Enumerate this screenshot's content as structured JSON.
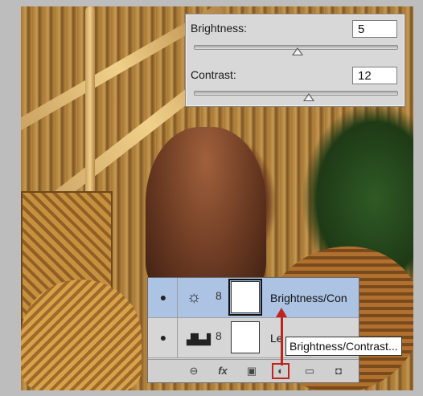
{
  "properties_panel": {
    "brightness_label": "Brightness:",
    "brightness_value": "5",
    "contrast_label": "Contrast:",
    "contrast_value": "12"
  },
  "layers_panel": {
    "layers": [
      {
        "name": "Brightness/Con",
        "icon": "sun-icon",
        "selected": true
      },
      {
        "name": "Le",
        "icon": "levels-icon",
        "selected": false
      }
    ],
    "toolbar": {
      "link_icon": "⊖",
      "fx_label": "fx",
      "mask_icon": "▣",
      "adjustment_icon": "◐",
      "folder_icon": "▭",
      "new_layer_icon": "◘"
    }
  },
  "tooltip": {
    "text": "Brightness/Contrast..."
  },
  "colors": {
    "selected_row": "#adc3e4",
    "highlight_red": "#c0241f",
    "panel_gray": "#d6d6d6"
  }
}
